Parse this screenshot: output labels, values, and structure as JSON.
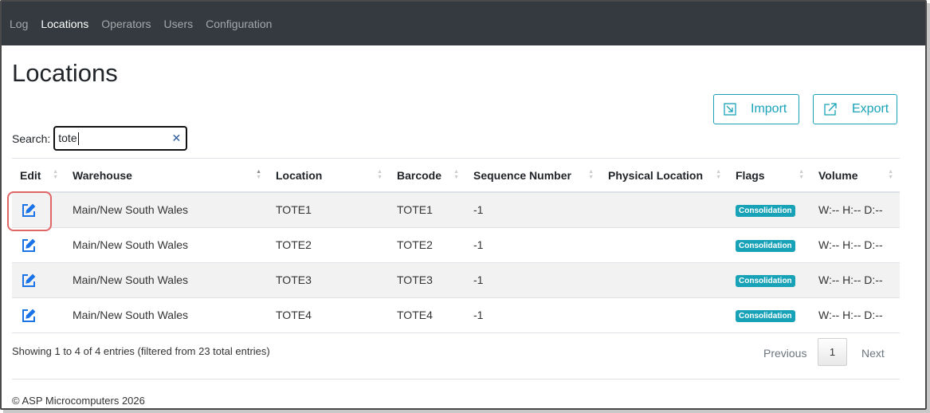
{
  "nav": {
    "items": [
      {
        "label": "Log",
        "active": false
      },
      {
        "label": "Locations",
        "active": true
      },
      {
        "label": "Operators",
        "active": false
      },
      {
        "label": "Users",
        "active": false
      },
      {
        "label": "Configuration",
        "active": false
      }
    ]
  },
  "page": {
    "title": "Locations"
  },
  "toolbar": {
    "import_label": "Import",
    "export_label": "Export"
  },
  "search": {
    "label": "Search:",
    "value": "tote"
  },
  "table": {
    "headers": [
      "Edit",
      "Warehouse",
      "Location",
      "Barcode",
      "Sequence Number",
      "Physical Location",
      "Flags",
      "Volume"
    ],
    "sorted_column": "Warehouse",
    "rows": [
      {
        "warehouse": "Main/New South Wales",
        "location": "TOTE1",
        "barcode": "TOTE1",
        "sequence": "-1",
        "physical": "",
        "flag": "Consolidation",
        "volume": "W:-- H:-- D:--"
      },
      {
        "warehouse": "Main/New South Wales",
        "location": "TOTE2",
        "barcode": "TOTE2",
        "sequence": "-1",
        "physical": "",
        "flag": "Consolidation",
        "volume": "W:-- H:-- D:--"
      },
      {
        "warehouse": "Main/New South Wales",
        "location": "TOTE3",
        "barcode": "TOTE3",
        "sequence": "-1",
        "physical": "",
        "flag": "Consolidation",
        "volume": "W:-- H:-- D:--"
      },
      {
        "warehouse": "Main/New South Wales",
        "location": "TOTE4",
        "barcode": "TOTE4",
        "sequence": "-1",
        "physical": "",
        "flag": "Consolidation",
        "volume": "W:-- H:-- D:--"
      }
    ]
  },
  "pagination": {
    "info": "Showing 1 to 4 of 4 entries (filtered from 23 total entries)",
    "previous_label": "Previous",
    "current_page": "1",
    "next_label": "Next"
  },
  "footer": {
    "text": "© ASP Microcomputers 2026"
  },
  "colors": {
    "navbar": "#343a40",
    "accent": "#17a2b8",
    "edit_icon": "#1a73e8",
    "highlight": "#e06666"
  },
  "icons": {
    "edit": "pencil-square-icon",
    "import": "import-icon",
    "export": "external-link-icon",
    "clear": "close-icon"
  }
}
